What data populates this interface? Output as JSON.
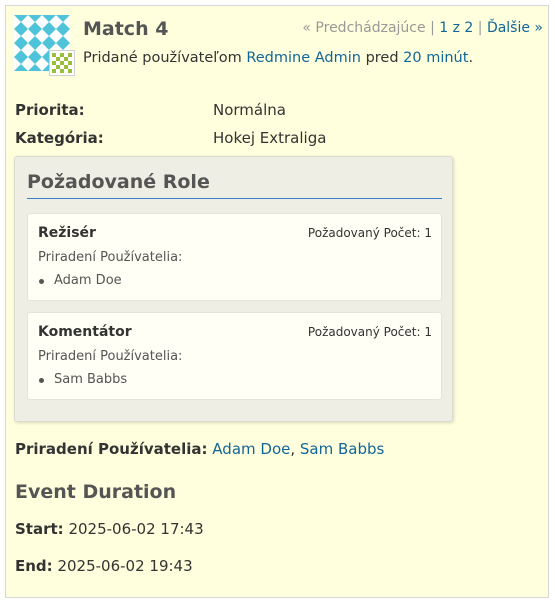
{
  "issue": {
    "subject": "Match 4",
    "nav": {
      "prev": "« Predchádzajúce",
      "position": "1 z 2",
      "next": "Ďalšie »"
    },
    "author": {
      "prefix": "Pridané používateľom",
      "name": "Redmine Admin",
      "middle": "pred",
      "ago": "20 minút",
      "suffix": "."
    },
    "attributes": [
      {
        "label": "Priorita:",
        "value": "Normálna"
      },
      {
        "label": "Kategória:",
        "value": "Hokej Extraliga"
      }
    ],
    "roles": {
      "title": "Požadované Role",
      "items": [
        {
          "name": "Režisér",
          "count_label": "Požadovaný Počet: 1",
          "sub_label": "Priradení Používatelia:",
          "users": [
            "Adam Doe"
          ]
        },
        {
          "name": "Komentátor",
          "count_label": "Požadovaný Počet: 1",
          "sub_label": "Priradení Používatelia:",
          "users": [
            "Sam Babbs"
          ]
        }
      ]
    },
    "assigned": {
      "label": "Priradení Používatelia:",
      "users": [
        "Adam Doe",
        "Sam Babbs"
      ],
      "separator": ","
    },
    "event": {
      "title": "Event Duration",
      "start_label": "Start:",
      "start_value": "2025-06-02 17:43",
      "end_label": "End:",
      "end_value": "2025-06-02 19:43"
    }
  }
}
